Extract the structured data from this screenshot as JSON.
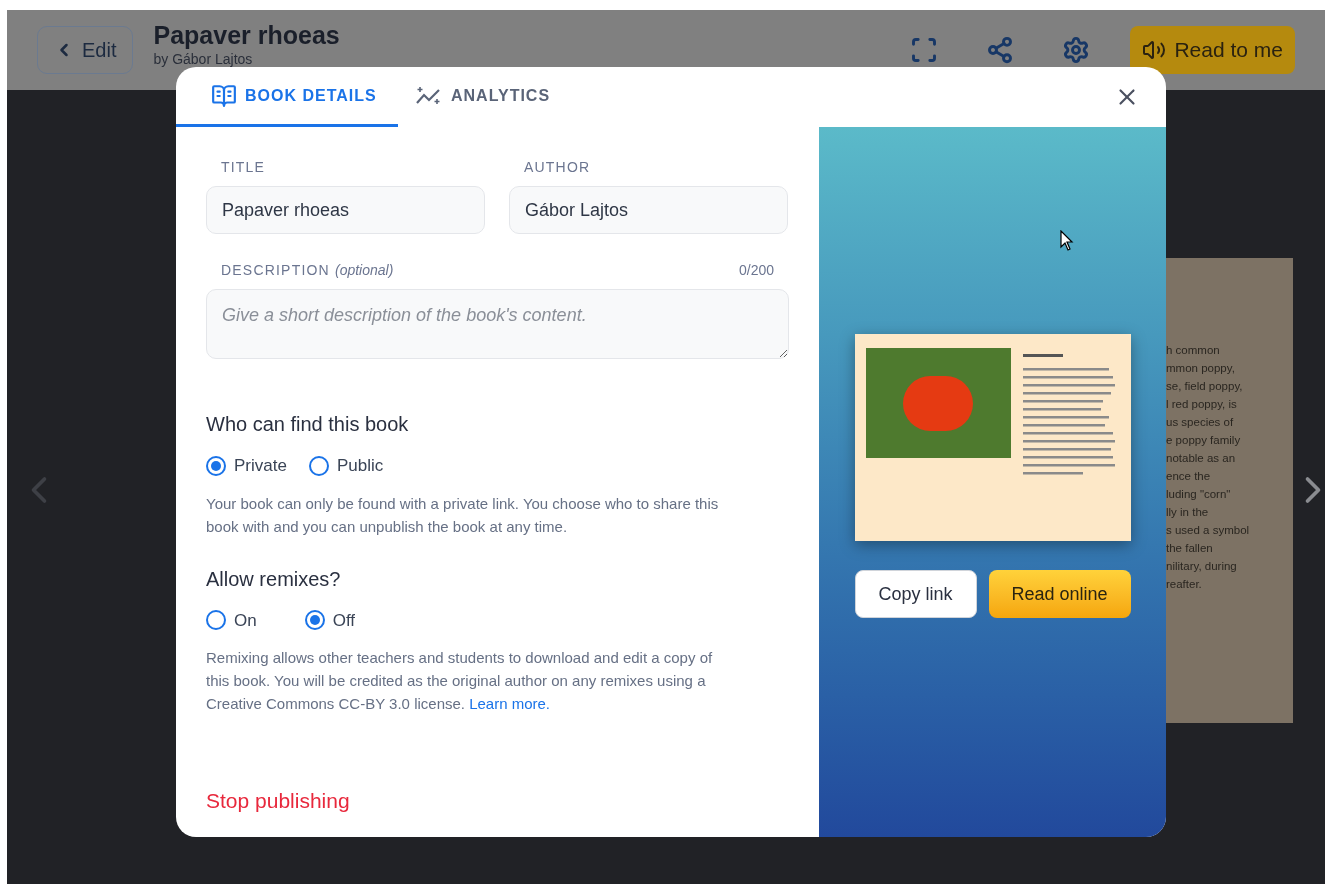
{
  "topbar": {
    "back": "Edit",
    "title": "Papaver rhoeas",
    "byline": "by Gábor Lajtos",
    "read_button": "Read to me"
  },
  "background_page": {
    "lines": [
      "h common",
      "mmon poppy,",
      "se, field poppy,",
      "l red poppy, is",
      "us species of",
      "e poppy family",
      "notable as an",
      "ence the",
      "luding \"corn\"",
      "lly in the",
      "s used a symbol",
      "the fallen",
      "nilitary, during",
      "reafter."
    ]
  },
  "modal": {
    "tabs": [
      {
        "label": "BOOK DETAILS",
        "selected": true,
        "kind": "details"
      },
      {
        "label": "ANALYTICS",
        "selected": false,
        "kind": "analytics"
      }
    ],
    "title_field": {
      "label": "TITLE",
      "value": "Papaver rhoeas"
    },
    "author_field": {
      "label": "AUTHOR",
      "value": "Gábor Lajtos"
    },
    "description_field": {
      "label": "DESCRIPTION",
      "optional": "(optional)",
      "counter": "0/200",
      "placeholder": "Give a short description of the book's content."
    },
    "visibility": {
      "heading": "Who can find this book",
      "options": [
        {
          "label": "Private",
          "selected": true
        },
        {
          "label": "Public",
          "selected": false
        }
      ],
      "help": "Your book can only be found with a private link. You choose who to share this book with and you can unpublish the book at any time."
    },
    "remix": {
      "heading": "Allow remixes?",
      "options": [
        {
          "label": "On",
          "selected": false
        },
        {
          "label": "Off",
          "selected": true
        }
      ],
      "help": "Remixing allows other teachers and students to download and edit a copy of this book. You will be credited as the original author on any remixes using a Creative Commons CC-BY 3.0 license.",
      "link": "Learn more."
    },
    "stop": "Stop publishing",
    "copy_button": "Copy link",
    "read_button": "Read online"
  }
}
